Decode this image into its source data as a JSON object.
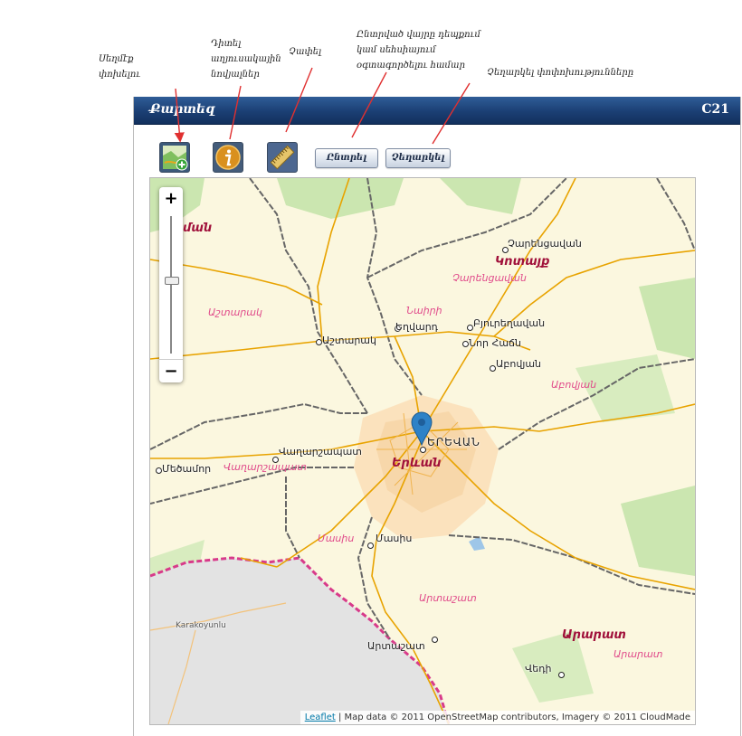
{
  "annotations": {
    "change_layer": "Սեղմէք փոխելու",
    "view_tech_info": "Դիտել աղյուսակային նովյալներ",
    "measure": "Չափել",
    "select_desc": "Ընտրված վայրը դեպքում կամ սեհսիայում օգտագործելու համար",
    "cancel_desc": "Չեղարկել փոփոխությունները"
  },
  "header": {
    "title": "Քարտեզ",
    "code": "C21"
  },
  "toolbar": {
    "layer_icon": "map-add-layer-icon",
    "info_icon": "info-icon",
    "ruler_icon": "ruler-icon",
    "select_label": "Ընտրել",
    "cancel_label": "Չեղարկել"
  },
  "map": {
    "zoom_in": "+",
    "zoom_out": "−",
    "zoom_level_fraction": 0.53,
    "attribution_link": "Leaflet",
    "attribution_text": " | Map data © 2011 OpenStreetMap contributors, Imagery © 2011 CloudMade",
    "cities": [
      "Չարենցավան",
      "Բյուրեղավան",
      "Նոր Հաճն",
      "Աբովյան",
      "Եղվարդ",
      "Աշտարակ",
      "ԵՐԵՎԱՆ",
      "Վաղարշապատ",
      "Մեծամոր",
      "Մասիս",
      "Արտաշատ",
      "Վեդի",
      "Karakoyunlu"
    ],
    "districts": [
      "Չարենցավան",
      "Աշտարակ",
      "Նաիրի",
      "Աբովյան",
      "Վաղարշապատ",
      "Մասիս",
      "Արտաշատ",
      "Արարատ"
    ],
    "regions": [
      "Կոտայք",
      "Երևան",
      "Արարատ"
    ],
    "partial_region": "ման",
    "colors": {
      "roads": "#e8a300",
      "border_pink": "#d83a8a",
      "urban": "#fbe2bd",
      "turkey": "#e0e0e0",
      "marker": "#2e82c7"
    }
  }
}
